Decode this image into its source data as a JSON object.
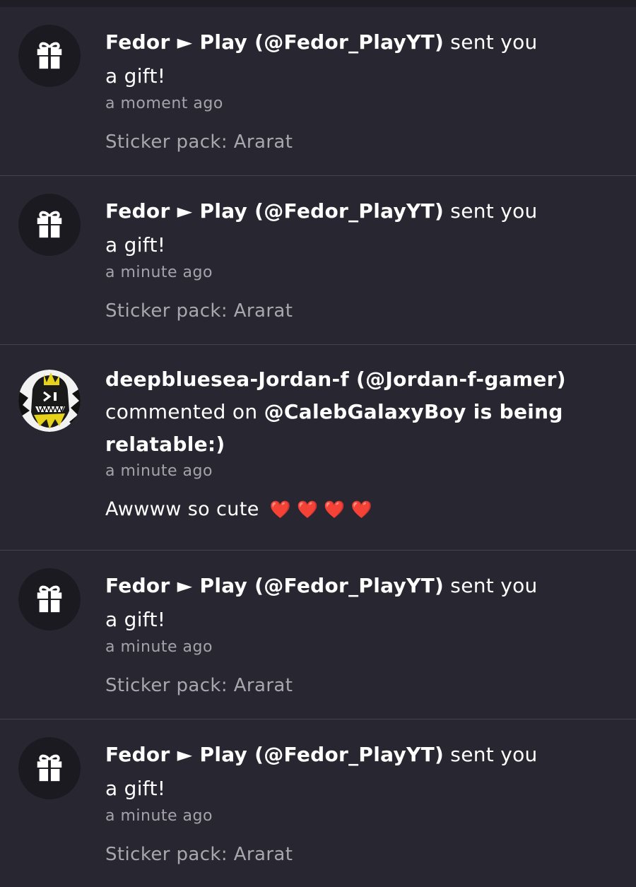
{
  "notifications": [
    {
      "type": "gift",
      "actor": "Fedor ► Play (@Fedor_PlayYT)",
      "action_1": " sent you",
      "action_2": "a gift!",
      "time": "a moment ago",
      "detail": "Sticker pack: Ararat",
      "icon": "gift-icon"
    },
    {
      "type": "gift",
      "actor": "Fedor ► Play (@Fedor_PlayYT)",
      "action_1": " sent you",
      "action_2": "a gift!",
      "time": "a minute ago",
      "detail": "Sticker pack: Ararat",
      "icon": "gift-icon"
    },
    {
      "type": "comment",
      "actor": "deepbluesea-Jordan-f (@Jordan-f-gamer)",
      "action": "commented on ",
      "target": "@CalebGalaxyBoy is being relatable:)",
      "time": "a minute ago",
      "comment_text": "Awwww so cute",
      "comment_emoji": "❤️ ❤️ ❤️ ❤️"
    },
    {
      "type": "gift",
      "actor": "Fedor ► Play (@Fedor_PlayYT)",
      "action_1": " sent you",
      "action_2": "a gift!",
      "time": "a minute ago",
      "detail": "Sticker pack: Ararat",
      "icon": "gift-icon"
    },
    {
      "type": "gift",
      "actor": "Fedor ► Play (@Fedor_PlayYT)",
      "action_1": " sent you",
      "action_2": "a gift!",
      "time": "a minute ago",
      "detail": "Sticker pack: Ararat",
      "icon": "gift-icon"
    }
  ],
  "colors": {
    "background": "#282630",
    "divider": "#45434c",
    "muted_text": "#a5a3aa",
    "heart": "#e0222e"
  }
}
